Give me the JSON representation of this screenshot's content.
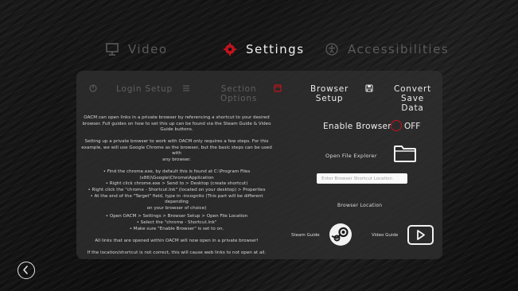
{
  "topnav": {
    "video": "Video",
    "settings": "Settings",
    "accessibilities": "Accessibilities"
  },
  "subtabs": {
    "login_setup": "Login Setup",
    "section_options_1": "Section",
    "section_options_2": "Options",
    "browser_setup_1": "Browser",
    "browser_setup_2": "Setup",
    "convert_save_1": "Convert Save",
    "convert_save_2": "Data"
  },
  "info": {
    "p1": [
      "OACM can open links in a private browser by referencing a shortcut to your desired",
      "browser. Full guides on how to set this up can be found via the Steam Guide & Video",
      "Guide buttons."
    ],
    "p2": [
      "Setting up a private browser to work with OACM only requires a few steps. For this",
      "example, we will use Google Chrome as the browser, but the basic steps can be used with",
      "any browser."
    ],
    "steps": [
      "• Find the chrome.exe, by default this is found at C:\\Program Files",
      "(x86)\\Google\\Chrome\\Application",
      "• Right click chrome.exe > Send to > Desktop (create shortcut)",
      "• Right click the \"chrome - Shortcut.lnk\" (located on your desktop) > Properties",
      "• At the end of the \"Target\" field, type in -incognito (This part will be different depending",
      "on your browser of choice)",
      "• Open OACM > Settings > Browser Setup > Open File Location",
      "• Select the \"chrome - Shortcut.lnk\"",
      "• Make sure \"Enable Browser\" is set to on."
    ],
    "p3": "All links that are opened within OACM will now open in a private browser!",
    "p4": "If the location/shortcut is not correct, this will cause web links to not open at all."
  },
  "browser": {
    "enable_label": "Enable Browser",
    "toggle_state": "OFF",
    "open_explorer_label": "Open File Explorer",
    "path_placeholder": "Enter Browser Shortcut Location",
    "path_value": "",
    "location_label": "Browser Location",
    "steam_guide_label": "Steam Guide",
    "video_guide_label": "Video Guide"
  },
  "colors": {
    "accent_red": "#c0141c",
    "panel": "#2e2e2e",
    "dim_text": "#5a5a5a"
  },
  "icons": {
    "video": "monitor-icon",
    "settings": "gear-icon",
    "accessibilities": "accessibility-icon",
    "login": "power-icon",
    "section": "menu-icon",
    "browser": "browser-window-icon",
    "convert": "save-icon",
    "explorer": "folder-icon",
    "steam": "steam-icon",
    "video_guide": "play-icon",
    "back": "back-arrow-icon"
  }
}
